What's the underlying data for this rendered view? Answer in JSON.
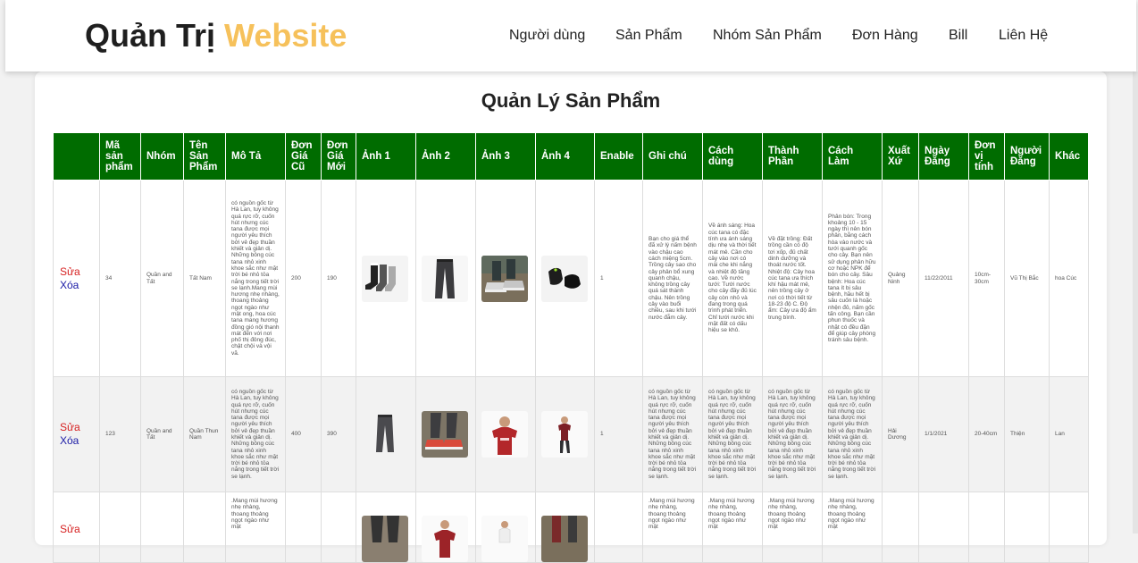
{
  "header": {
    "brand_dark": "Quản Trị",
    "brand_accent": "Website",
    "nav": [
      "Người dùng",
      "Sản Phẩm",
      "Nhóm Sản Phẩm",
      "Đơn Hàng",
      "Bill",
      "Liên Hệ"
    ]
  },
  "colors": {
    "accent": "#f6c15b",
    "table_header": "#006c00",
    "edit": "#d61f1f",
    "delete": "#1a1aa6"
  },
  "page": {
    "title": "Quản Lý Sản Phẩm"
  },
  "table": {
    "columns": [
      "",
      "Mã sản phẩm",
      "Nhóm",
      "Tên Sản Phẩm",
      "Mô Tả",
      "Đơn Giá Cũ",
      "Đơn Giá Mới",
      "Ảnh 1",
      "Ảnh 2",
      "Ảnh 3",
      "Ảnh 4",
      "Enable",
      "Ghi chú",
      "Cách dùng",
      "Thành Phần",
      "Cách Làm",
      "Xuất Xứ",
      "Ngày Đăng",
      "Đơn vị tính",
      "Người Đăng",
      "Khác"
    ],
    "actions": {
      "edit": "Sửa",
      "delete": "Xóa"
    },
    "rows": [
      {
        "ma": "34",
        "nhom": "Quần and Tất",
        "ten": "Tất Nam",
        "mota": "có nguồn gốc từ Hà Lan, tuy không quá rực rỡ, cuốn hút nhưng cúc tana được mọi người yêu thích bởi vẻ đẹp thuần khiết và giản dị. Những bông cúc tana nhỏ xinh khoe sắc như mặt trời bé nhỏ tỏa nắng trong tiết trời se lạnh.Mang mùi hương nhẹ nhàng, thoang thoảng ngọt ngào như mật ong, hoa cúc tana mang hương đồng gió nội thanh mát đến với nơi phố thị đông đúc, chật chội và vội vã.",
        "gia_cu": "200",
        "gia_moi": "190",
        "images": [
          "socks-image",
          "trousers-image",
          "sneakers-legs-image",
          "black-sneakers-image"
        ],
        "enable": "1",
        "ghichu": "Bạn cho giá thể đã xử lý nấm bệnh vào chậu cao cách miệng 5cm. Trồng cây sao cho cây phân bổ xung quanh chậu, không trồng cây quá sát thành chậu. Nên trồng cây vào buổi chiều, sau khi tưới nước đẫm cây.",
        "cachdung": "Về ánh sáng: Hoa cúc tana có đặc tính ưa ánh sáng dịu nhẹ và thời tiết mát mẻ. Cần cho cây vào nơi có mái che khi nắng và nhiệt độ tăng cao. Về nước tưới: Tưới nước cho cây đầy đủ lúc cây còn nhỏ và đang trong quá trình phát triển. Chỉ tưới nước khi mặt đất có dấu hiệu se khô.",
        "thanhphan": "Về đặt trồng: Đất trồng cần có độ tơi xốp, đủ chất dinh dưỡng và thoát nước tốt. Nhiệt độ: Cây hoa cúc tana ưa thích khí hậu mát mẻ, nên trồng cây ở nơi có thời tiết từ 18-23 độ C. Độ ẩm: Cây ưa độ ẩm trung bình.",
        "cachlam": "Phân bón: Trong khoảng 10 - 15 ngày thì nên bón phân, bằng cách hòa vào nước và tưới quanh gốc cho cây. Bạn nên sử dụng phân hữu cơ hoặc NPK để bón cho cây. Sâu bệnh: Hoa cúc tana ít bị sâu bệnh, hầu hết bị sâu cuốn lá hoặc nhện đỏ, nấm gốc tấn công. Bạn cần phun thuốc và nhặt có đều đặn để giúp cây phòng tránh sâu bệnh.",
        "xuatxu": "Quảng Ninh",
        "ngay": "11/22/2011",
        "donvi": "10cm-30cm",
        "nguoidang": "Vũ Thị Bắc",
        "khac": "hoa Cúc"
      },
      {
        "ma": "123",
        "nhom": "Quần and Tất",
        "ten": "Quần Thun Nam",
        "mota": "có nguồn gốc từ Hà Lan, tuy không quá rực rỡ, cuốn hút nhưng cúc tana được mọi người yêu thích bởi vẻ đẹp thuần khiết và giản dị. Những bông cúc tana nhỏ xinh khoe sắc như mặt trời bé nhỏ tỏa nắng trong tiết trời se lạnh.",
        "gia_cu": "400",
        "gia_moi": "390",
        "images": [
          "grey-pants-image",
          "legs-sneakers-image",
          "man-red-tshirt-image",
          "man-maroon-tshirt-image"
        ],
        "enable": "1",
        "ghichu": "có nguồn gốc từ Hà Lan, tuy không quá rực rỡ, cuốn hút nhưng cúc tana được mọi người yêu thích bởi vẻ đẹp thuần khiết và giản dị. Những bông cúc tana nhỏ xinh khoe sắc như mặt trời bé nhỏ tỏa nắng trong tiết trời se lạnh.",
        "cachdung": "có nguồn gốc từ Hà Lan, tuy không quá rực rỡ, cuốn hút nhưng cúc tana được mọi người yêu thích bởi vẻ đẹp thuần khiết và giản dị. Những bông cúc tana nhỏ xinh khoe sắc như mặt trời bé nhỏ tỏa nắng trong tiết trời se lạnh.",
        "thanhphan": "có nguồn gốc từ Hà Lan, tuy không quá rực rỡ, cuốn hút nhưng cúc tana được mọi người yêu thích bởi vẻ đẹp thuần khiết và giản dị. Những bông cúc tana nhỏ xinh khoe sắc như mặt trời bé nhỏ tỏa nắng trong tiết trời se lạnh.",
        "cachlam": "có nguồn gốc từ Hà Lan, tuy không quá rực rỡ, cuốn hút nhưng cúc tana được mọi người yêu thích bởi vẻ đẹp thuần khiết và giản dị. Những bông cúc tana nhỏ xinh khoe sắc như mặt trời bé nhỏ tỏa nắng trong tiết trời se lạnh.",
        "xuatxu": "Hải Dương",
        "ngay": "1/1/2021",
        "donvi": "20-40cm",
        "nguoidang": "Thiện",
        "khac": "Lan"
      },
      {
        "mota": ".Mang mùi hương nhẹ nhàng, thoang thoảng ngọt ngào như mật",
        "images": [
          "model-pants-image",
          "man-tshirt-image",
          "man-standing-image",
          "legs-image"
        ],
        "ghichu": ".Mang mùi hương nhẹ nhàng, thoang thoảng ngọt ngào như mật",
        "cachdung": ".Mang mùi hương nhẹ nhàng, thoang thoảng ngọt ngào như mật",
        "thanhphan": ".Mang mùi hương nhẹ nhàng, thoang thoảng ngọt ngào như mật",
        "cachlam": ".Mang mùi hương nhẹ nhàng, thoang thoảng ngọt ngào như mật"
      }
    ]
  }
}
